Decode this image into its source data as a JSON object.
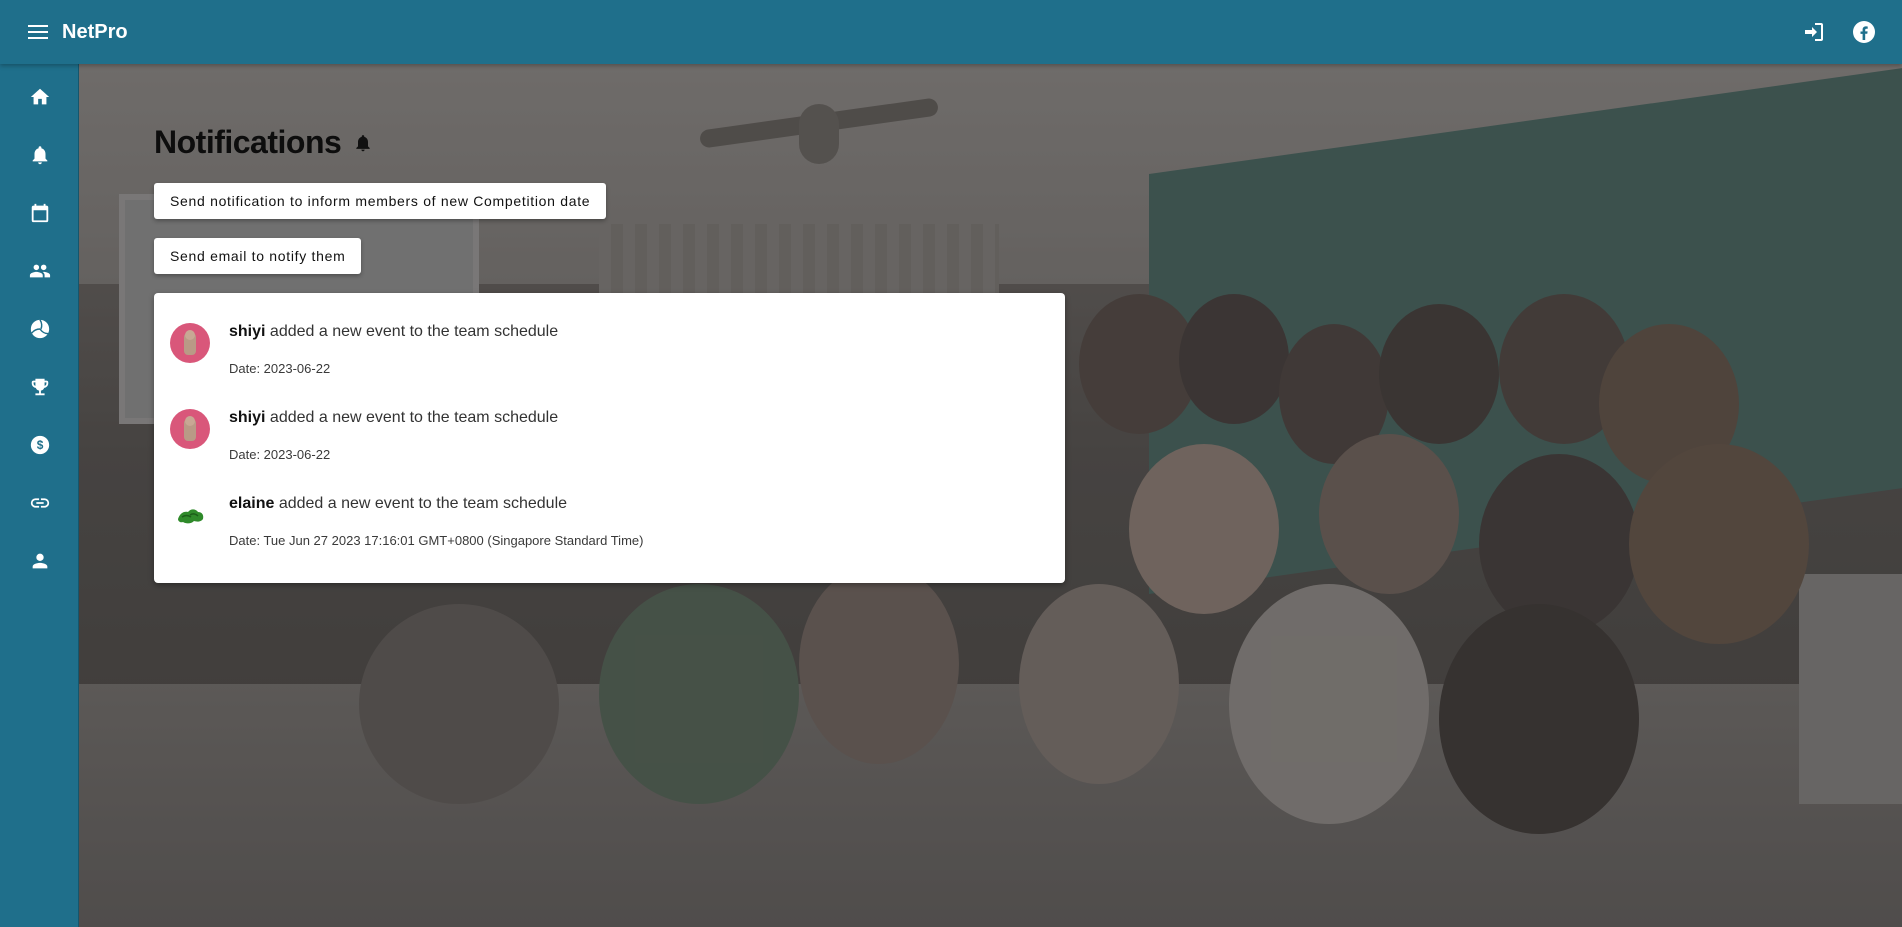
{
  "app": {
    "title": "NetPro"
  },
  "header": {
    "menu_icon": "hamburger-menu-icon",
    "login_icon": "login-icon",
    "facebook_icon": "facebook-icon"
  },
  "sidebar": {
    "items": [
      {
        "icon": "home-icon"
      },
      {
        "icon": "bell-icon"
      },
      {
        "icon": "calendar-icon"
      },
      {
        "icon": "group-icon"
      },
      {
        "icon": "volleyball-icon"
      },
      {
        "icon": "trophy-icon"
      },
      {
        "icon": "dollar-icon"
      },
      {
        "icon": "link-icon"
      },
      {
        "icon": "person-icon"
      }
    ]
  },
  "page": {
    "title": "Notifications",
    "title_icon": "bell-icon"
  },
  "actions": {
    "notify_label": "Send notification to inform members of new Competition date",
    "email_label": "Send email to notify them"
  },
  "notifications": [
    {
      "user": "shiyi",
      "message": "added a new event to the team schedule",
      "date": "Date: 2023-06-22",
      "avatar": "pink"
    },
    {
      "user": "shiyi",
      "message": "added a new event to the team schedule",
      "date": "Date: 2023-06-22",
      "avatar": "pink"
    },
    {
      "user": "elaine",
      "message": "added a new event to the team schedule",
      "date": "Date: Tue Jun 27 2023 17:16:01 GMT+0800 (Singapore Standard Time)",
      "avatar": "green"
    }
  ],
  "colors": {
    "appbar": "#1f6f8b",
    "panel": "#ffffff",
    "avatar_pink": "#d9577a"
  }
}
